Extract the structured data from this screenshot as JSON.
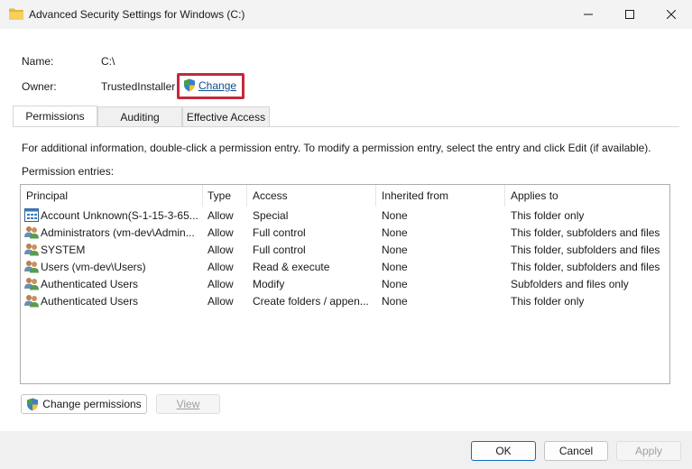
{
  "window": {
    "title": "Advanced Security Settings for Windows (C:)",
    "icon": "folder-icon"
  },
  "name": {
    "label": "Name:",
    "value": "C:\\"
  },
  "owner": {
    "label": "Owner:",
    "value": "TrustedInstaller",
    "change_label": "Change",
    "change_icon": "uac-shield-icon"
  },
  "tabs": [
    {
      "label": "Permissions",
      "active": true
    },
    {
      "label": "Auditing",
      "active": false
    },
    {
      "label": "Effective Access",
      "active": false
    }
  ],
  "info_text": "For additional information, double-click a permission entry. To modify a permission entry, select the entry and click Edit (if available).",
  "entries_label": "Permission entries:",
  "table": {
    "columns": [
      "Principal",
      "Type",
      "Access",
      "Inherited from",
      "Applies to"
    ],
    "rows": [
      {
        "icon": "unknown-account-icon",
        "principal": "Account Unknown(S-1-15-3-65...",
        "type": "Allow",
        "access": "Special",
        "inherited": "None",
        "applies": "This folder only"
      },
      {
        "icon": "users-group-icon",
        "principal": "Administrators (vm-dev\\Admin...",
        "type": "Allow",
        "access": "Full control",
        "inherited": "None",
        "applies": "This folder, subfolders and files"
      },
      {
        "icon": "users-group-icon",
        "principal": "SYSTEM",
        "type": "Allow",
        "access": "Full control",
        "inherited": "None",
        "applies": "This folder, subfolders and files"
      },
      {
        "icon": "users-group-icon",
        "principal": "Users (vm-dev\\Users)",
        "type": "Allow",
        "access": "Read & execute",
        "inherited": "None",
        "applies": "This folder, subfolders and files"
      },
      {
        "icon": "users-group-icon",
        "principal": "Authenticated Users",
        "type": "Allow",
        "access": "Modify",
        "inherited": "None",
        "applies": "Subfolders and files only"
      },
      {
        "icon": "users-group-icon",
        "principal": "Authenticated Users",
        "type": "Allow",
        "access": "Create folders / appen...",
        "inherited": "None",
        "applies": "This folder only"
      }
    ]
  },
  "buttons": {
    "change_permissions": "Change permissions",
    "view": "View",
    "ok": "OK",
    "cancel": "Cancel",
    "apply": "Apply"
  },
  "colors": {
    "highlight_box": "#c5283d",
    "link": "#0f4c8c",
    "primary_border": "#0f6cbd"
  }
}
